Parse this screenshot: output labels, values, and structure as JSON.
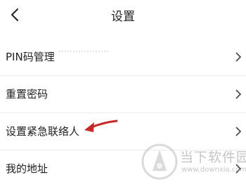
{
  "header": {
    "title": "设置",
    "back_icon": "back-arrow-icon"
  },
  "settings": {
    "items": [
      {
        "label": "PIN码管理"
      },
      {
        "label": "重置密码"
      },
      {
        "label": "设置紧急联络人"
      },
      {
        "label": "我的地址"
      }
    ]
  },
  "annotation": {
    "arrow_color": "#c62828"
  },
  "watermark": {
    "name": "当下软件园",
    "url": "www.downxia.com"
  }
}
